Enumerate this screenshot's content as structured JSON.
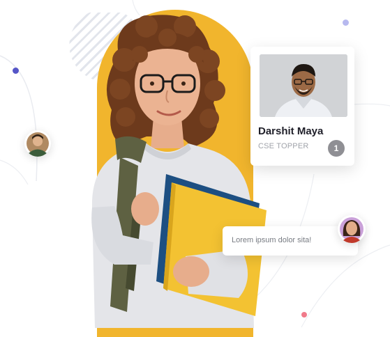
{
  "profile_card": {
    "name": "Darshit Maya",
    "role": "CSE TOPPER",
    "rank": "1"
  },
  "message": {
    "text": "Lorem ipsum dolor sita!"
  },
  "colors": {
    "accent_yellow": "#f1b52d",
    "dot_blue": "#5555c7",
    "dot_lavender": "#b7b9ef",
    "dot_pink": "#f07a8a",
    "badge_gray": "#8f8f94"
  },
  "icons": {
    "left_avatar": "person-avatar",
    "card_photo": "person-photo",
    "bubble_avatar": "person-avatar"
  }
}
